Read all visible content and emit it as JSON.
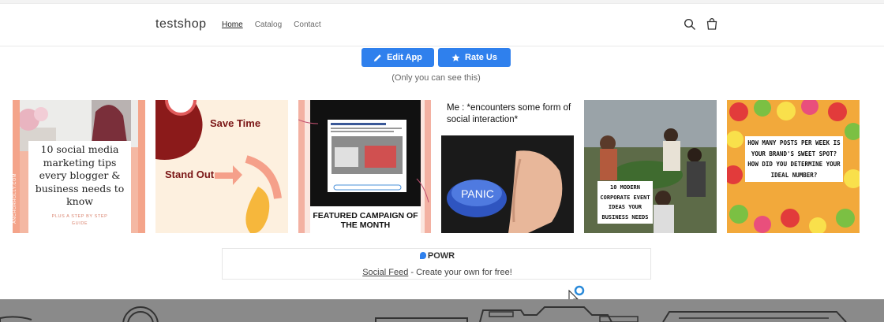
{
  "header": {
    "brand": "testshop",
    "nav": [
      {
        "label": "Home",
        "active": true
      },
      {
        "label": "Catalog",
        "active": false
      },
      {
        "label": "Contact",
        "active": false
      }
    ],
    "icons": [
      "search-icon",
      "cart-icon"
    ]
  },
  "app_buttons": {
    "edit_label": "Edit App",
    "rate_label": "Rate Us",
    "owner_note": "(Only you can see this)",
    "accent": "#2f80ed"
  },
  "feed": {
    "tiles": [
      {
        "text": "10 social media marketing tips every blogger & business needs to know",
        "subtext": "PLUS A STEP BY STEP GUIDE",
        "side_text": "ANCHORHOLLY.COM"
      },
      {
        "text_1": "Save Time",
        "text_2": "Stand Out"
      },
      {
        "caption": "FEATURED CAMPAIGN OF THE MONTH"
      },
      {
        "caption": "Me : *encounters some form of social interaction*",
        "button_text": "PANIC"
      },
      {
        "text": "10 MODERN CORPORATE EVENT IDEAS YOUR BUSINESS NEEDS"
      },
      {
        "text": "HOW MANY POSTS PER WEEK IS YOUR BRAND'S SWEET SPOT? HOW DID YOU DETERMINE YOUR IDEAL NUMBER?"
      }
    ]
  },
  "powr": {
    "logo_text": "POWR",
    "link_text": "Social Feed",
    "cta_rest": " - Create your own for free!"
  }
}
